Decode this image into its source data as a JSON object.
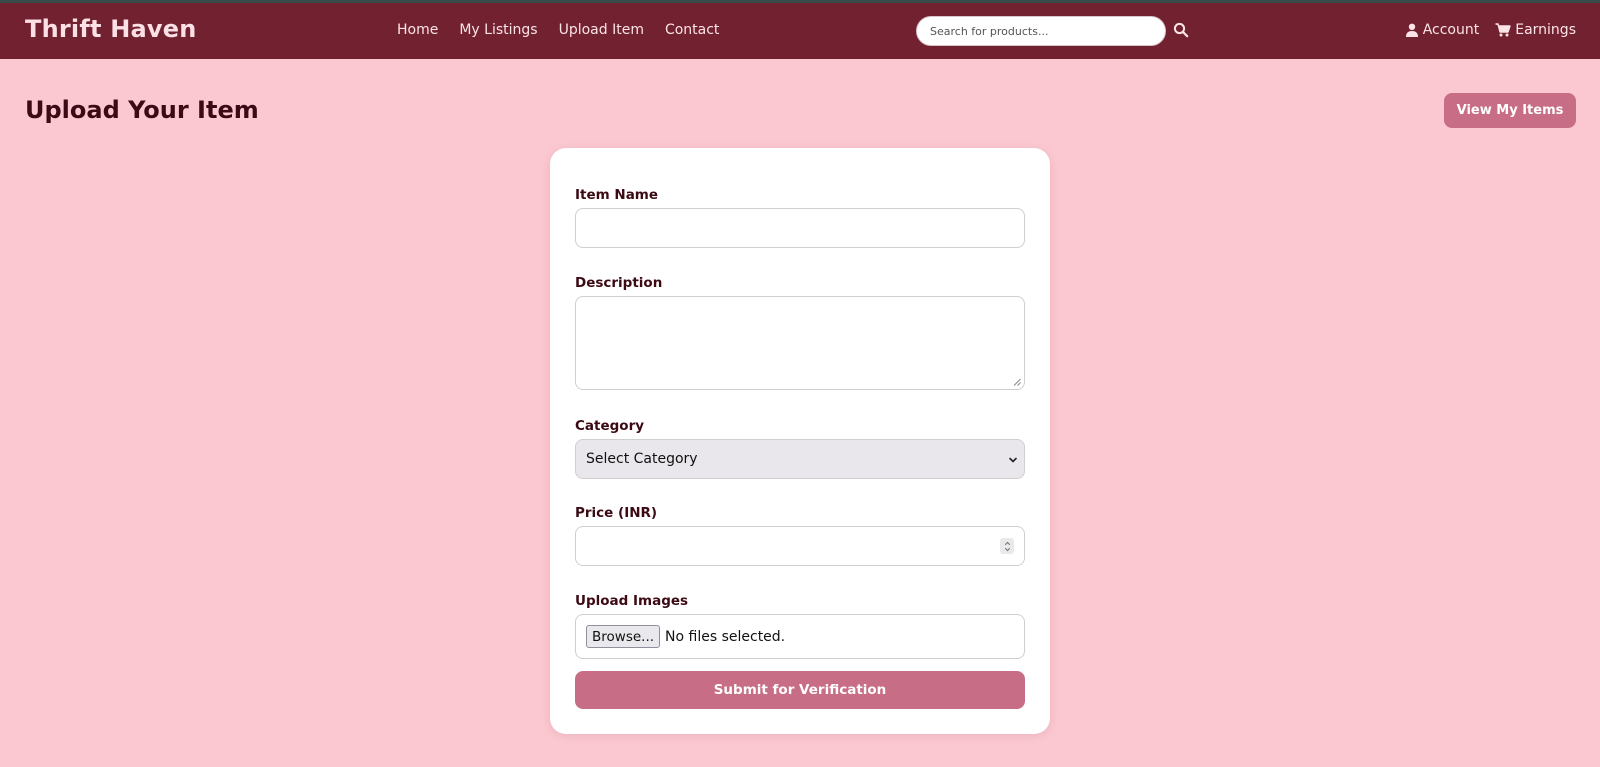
{
  "app": {
    "brand": "Thrift Haven"
  },
  "nav": {
    "links": [
      {
        "label": "Home"
      },
      {
        "label": "My Listings"
      },
      {
        "label": "Upload Item"
      },
      {
        "label": "Contact"
      }
    ],
    "search": {
      "placeholder": "Search for products...",
      "value": "",
      "icon": "search-icon"
    },
    "account": {
      "label": "Account",
      "icon": "user-icon"
    },
    "earnings": {
      "label": "Earnings",
      "icon": "cart-icon"
    }
  },
  "page": {
    "title": "Upload Your Item",
    "view_button": "View My Items"
  },
  "form": {
    "item_name": {
      "label": "Item Name",
      "value": ""
    },
    "description": {
      "label": "Description",
      "value": ""
    },
    "category": {
      "label": "Category",
      "selected": "Select Category"
    },
    "price": {
      "label": "Price (INR)",
      "value": ""
    },
    "images": {
      "label": "Upload Images",
      "browse_label": "Browse...",
      "status": "No files selected."
    },
    "submit_label": "Submit for Verification"
  },
  "colors": {
    "navbar": "#71212f",
    "background": "#fbc8d1",
    "accent_button": "#c76d86",
    "text_dark": "#3b0a14"
  }
}
